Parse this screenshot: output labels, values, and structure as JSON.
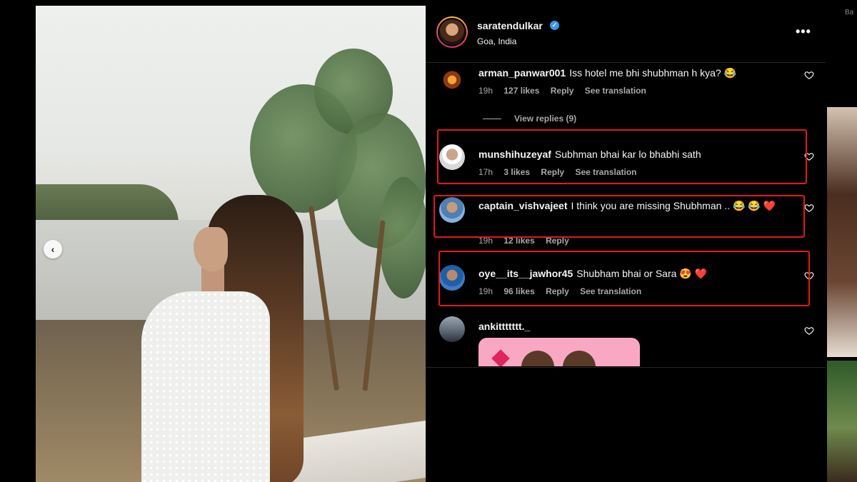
{
  "post": {
    "username": "saratendulkar",
    "location": "Goa, India"
  },
  "comments": [
    {
      "username": "arman_panwar001",
      "text": "Iss hotel me bhi shubhman h kya?",
      "emoji": "😂",
      "time": "19h",
      "likes": "127 likes",
      "reply": "Reply",
      "translation": "See translation",
      "view_replies": "View replies (9)"
    },
    {
      "username": "munshihuzeyaf",
      "text": "Subhman bhai kar lo bhabhi sath",
      "emoji": "",
      "time": "17h",
      "likes": "3 likes",
      "reply": "Reply",
      "translation": "See translation"
    },
    {
      "username": "captain_vishvajeet",
      "text": "I think you are missing Shubhman ..",
      "emoji": "😂 😂 ❤️",
      "time": "19h",
      "likes": "12 likes",
      "reply": "Reply"
    },
    {
      "username": "oye__its__jawhor45",
      "text": "Shubham bhai or Sara",
      "emoji": "😍 ❤️",
      "time": "19h",
      "likes": "96 likes",
      "reply": "Reply",
      "translation": "See translation"
    },
    {
      "username": "ankittttttt._",
      "text": "",
      "emoji": ""
    }
  ],
  "edge": {
    "label": "Ba"
  },
  "colors": {
    "background": "#000000",
    "text": "#f5f5f5",
    "muted": "#a8a8a8",
    "verified": "#3897f0",
    "highlight_box": "#e3191f"
  },
  "icons": [
    "chevron-left-icon",
    "verified-icon",
    "more-options-icon",
    "heart-icon"
  ]
}
